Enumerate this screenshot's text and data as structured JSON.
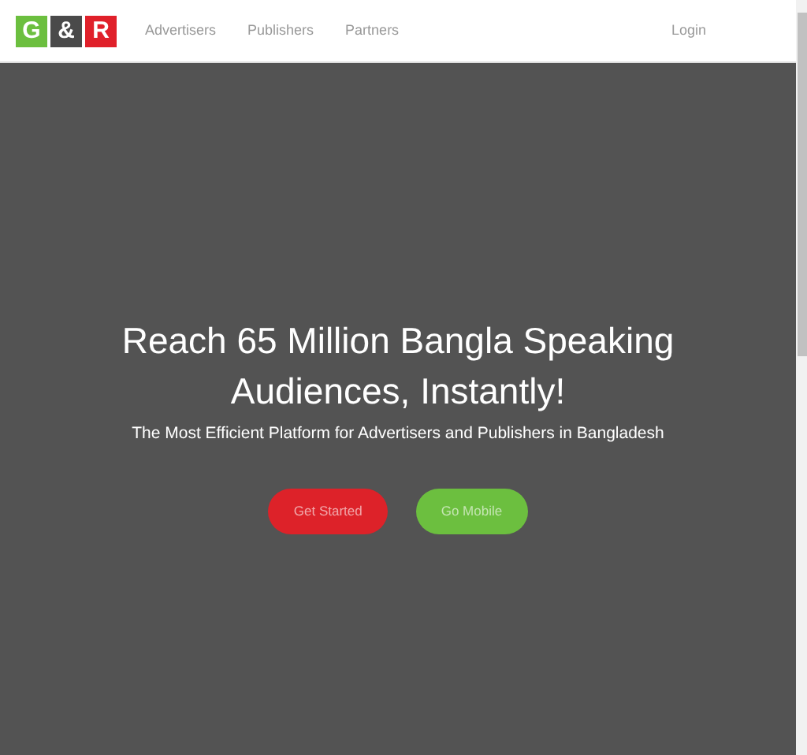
{
  "logo": {
    "letters": [
      {
        "text": "G",
        "color": "#6cbf3f"
      },
      {
        "text": "&",
        "color": "#4a4a4a"
      },
      {
        "text": "R",
        "color": "#e0202a"
      }
    ]
  },
  "nav": {
    "links": [
      "Advertisers",
      "Publishers",
      "Partners"
    ],
    "login": "Login"
  },
  "hero": {
    "heading": "Reach 65 Million Bangla Speaking Audiences, Instantly!",
    "subheading": "The Most Efficient Platform for Advertisers and Publishers in Bangladesh",
    "buttons": [
      {
        "label": "Get Started",
        "color": "#dd2229"
      },
      {
        "label": "Go Mobile",
        "color": "#6cbf3f"
      }
    ]
  }
}
